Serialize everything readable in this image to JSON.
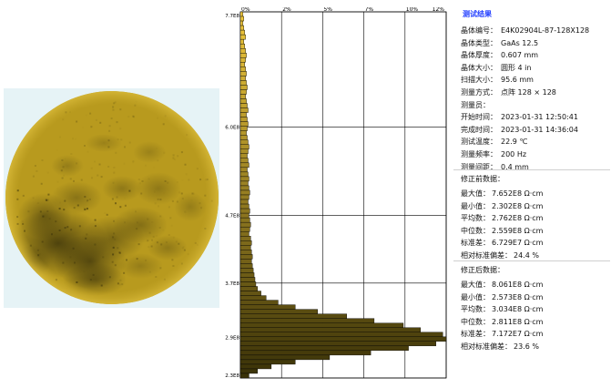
{
  "results": {
    "title": "测试结果",
    "info": [
      {
        "label": "晶体编号：",
        "value": "E4K02904L-87-128X128"
      },
      {
        "label": "晶体类型：",
        "value": "GaAs 12.5"
      },
      {
        "label": "晶体厚度：",
        "value": "0.607 mm"
      },
      {
        "label": "晶体大小：",
        "value": "圆形 4 in"
      },
      {
        "label": "扫描大小：",
        "value": "95.6 mm"
      },
      {
        "label": "测量方式：",
        "value": "点阵 128 × 128"
      },
      {
        "label": "测量员：",
        "value": ""
      },
      {
        "label": "开始时间：",
        "value": "2023-01-31 12:50:41"
      },
      {
        "label": "完成时间：",
        "value": "2023-01-31 14:36:04"
      },
      {
        "label": "测试温度：",
        "value": "22.9 ℃"
      },
      {
        "label": "测量频率：",
        "value": "200 Hz"
      },
      {
        "label": "测量间距：",
        "value": "0.4 mm"
      }
    ],
    "before": {
      "title": "修正前数据：",
      "stats": [
        {
          "label": "最大值：",
          "value": "7.652E8 Ω·cm"
        },
        {
          "label": "最小值：",
          "value": "2.302E8 Ω·cm"
        },
        {
          "label": "平均数：",
          "value": "2.762E8 Ω·cm"
        },
        {
          "label": "中位数：",
          "value": "2.559E8 Ω·cm"
        },
        {
          "label": "标准差：",
          "value": "6.729E7 Ω·cm"
        },
        {
          "label": "相对标准偏差：",
          "value": "24.4 %"
        }
      ]
    },
    "after": {
      "title": "修正后数据：",
      "stats": [
        {
          "label": "最大值：",
          "value": "8.061E8 Ω·cm"
        },
        {
          "label": "最小值：",
          "value": "2.573E8 Ω·cm"
        },
        {
          "label": "平均数：",
          "value": "3.034E8 Ω·cm"
        },
        {
          "label": "中位数：",
          "value": "2.811E8 Ω·cm"
        },
        {
          "label": "标准差：",
          "value": "7.172E7 Ω·cm"
        },
        {
          "label": "相对标准偏差：",
          "value": "23.6 %"
        }
      ]
    }
  },
  "colors": {
    "wafer_base": "#b89a1e",
    "wafer_dark": "#2e2808",
    "wafer_bg": "#e6f3f6",
    "bar_light": "#f0c83c",
    "bar_dark": "#3a3208",
    "title_blue": "#1f3cff"
  },
  "chart_data": {
    "type": "bar",
    "orientation": "horizontal",
    "title": "",
    "xlabel": "",
    "ylabel": "",
    "x_ticks": [
      "0%",
      "2%",
      "5%",
      "7%",
      "10%",
      "12%"
    ],
    "x_tick_values": [
      0,
      2.4,
      4.8,
      7.2,
      9.6,
      12.0
    ],
    "y_ticks": [
      "7.7E8",
      "6.0E8",
      "4.7E8",
      "3.7E8",
      "2.9E8",
      "2.3E8"
    ],
    "y_tick_values": [
      7.7,
      6.0,
      4.7,
      3.7,
      2.9,
      2.3
    ],
    "xlim": [
      0,
      12
    ],
    "grid": true,
    "series": [
      {
        "values": [
          0.15,
          0.2,
          0.15,
          0.2,
          0.25,
          0.3,
          0.2,
          0.25,
          0.3,
          0.35,
          0.3,
          0.25,
          0.3,
          0.35,
          0.3,
          0.35,
          0.4,
          0.35,
          0.3,
          0.35,
          0.4,
          0.45,
          0.35,
          0.4,
          0.45,
          0.4,
          0.35,
          0.4,
          0.45,
          0.5,
          0.45,
          0.4,
          0.45,
          0.5,
          0.4,
          0.45,
          0.5,
          0.45,
          0.5,
          0.55,
          0.5,
          0.45,
          0.5,
          0.55,
          0.5,
          0.55,
          0.6,
          0.55,
          0.5,
          0.6,
          0.65,
          0.6,
          0.65,
          0.7,
          0.65,
          0.7,
          0.75,
          0.8,
          0.85,
          0.9,
          1.0,
          1.2,
          1.5,
          2.2,
          3.2,
          4.5,
          6.2,
          7.8,
          9.5,
          10.5,
          11.8,
          12.0,
          11.4,
          9.8,
          7.6,
          5.2,
          3.2,
          1.8,
          1.0,
          0.5
        ]
      }
    ]
  }
}
